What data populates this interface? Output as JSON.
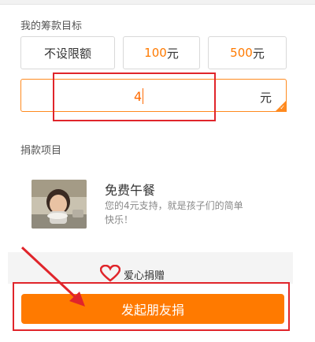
{
  "fundraising_goal": {
    "label": "我的筹款目标",
    "options": [
      {
        "text": "不设限额"
      },
      {
        "amount": "100",
        "unit": "元"
      },
      {
        "amount": "500",
        "unit": "元"
      }
    ],
    "custom_amount": "4",
    "custom_unit": "元"
  },
  "donation_project": {
    "label": "捐款项目",
    "title": "免费午餐",
    "description": "您的4元支持，就是孩子们的简单快乐！"
  },
  "footer": {
    "brand": "爱心捐赠"
  },
  "launch_button_label": "发起朋友捐",
  "colors": {
    "accent": "#ff7a00",
    "annotation": "#e0252b"
  },
  "icons": [
    "heart-logo-icon",
    "checkmark-icon",
    "arrow-annotation-icon"
  ]
}
